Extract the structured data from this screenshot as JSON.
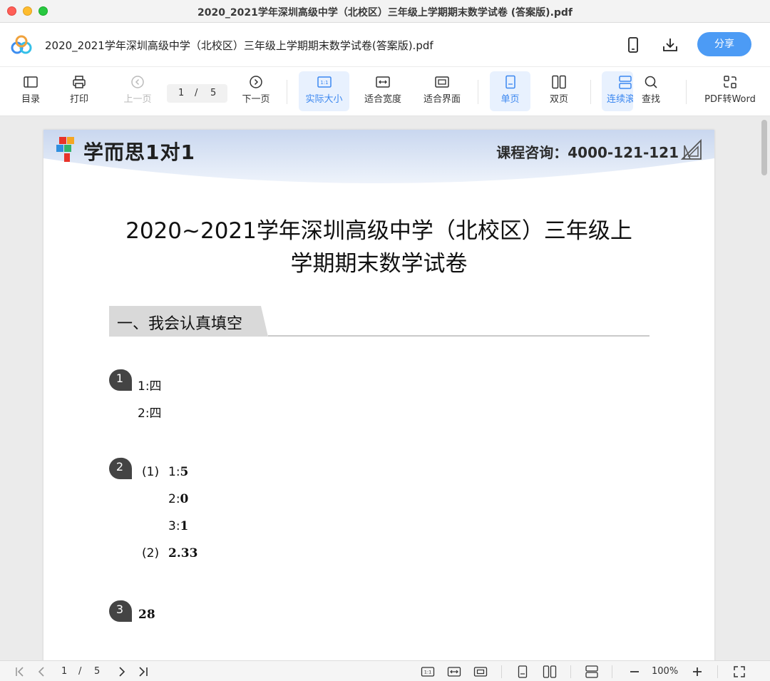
{
  "window": {
    "title": "2020_2021学年深圳高级中学（北校区）三年级上学期期末数学试卷 (答案版).pdf"
  },
  "header": {
    "doc_title": "2020_2021学年深圳高级中学（北校区）三年级上学期期末数学试卷(答案版).pdf",
    "share_label": "分享"
  },
  "toolbar": {
    "toc_label": "目录",
    "print_label": "打印",
    "prev_label": "上一页",
    "current_page": "1",
    "page_sep": "/",
    "total_pages": "5",
    "next_label": "下一页",
    "actual_size_label": "实际大小",
    "fit_width_label": "适合宽度",
    "fit_page_label": "适合界面",
    "single_label": "单页",
    "double_label": "双页",
    "continuous_label": "连续滚",
    "find_label": "查找",
    "convert_label": "PDF转Word"
  },
  "document": {
    "brand": "学而思1对1",
    "consult": "课程咨询：4000-121-121",
    "title_line1": "2020~2021学年深圳高级中学（北校区）三年级上",
    "title_line2": "学期期末数学试卷",
    "section1": "一、我会认真填空",
    "q1": {
      "num": "1",
      "a1": "1:四",
      "a2": "2:四"
    },
    "q2": {
      "num": "2",
      "part1": "(1)",
      "a1_key": "1:",
      "a1_val": "5",
      "a2_key": "2:",
      "a2_val": "0",
      "a3_key": "3:",
      "a3_val": "1",
      "part2": "(2)",
      "part2_val": "2.33"
    },
    "q3": {
      "num": "3",
      "a1": "28"
    }
  },
  "statusbar": {
    "current_page": "1",
    "page_sep": "/",
    "total_pages": "5",
    "zoom": "100%"
  },
  "colors": {
    "accent": "#4c9bf5",
    "active_bg": "#e8f1fe",
    "badge": "#444444",
    "section_bg": "#d9d9d9"
  }
}
